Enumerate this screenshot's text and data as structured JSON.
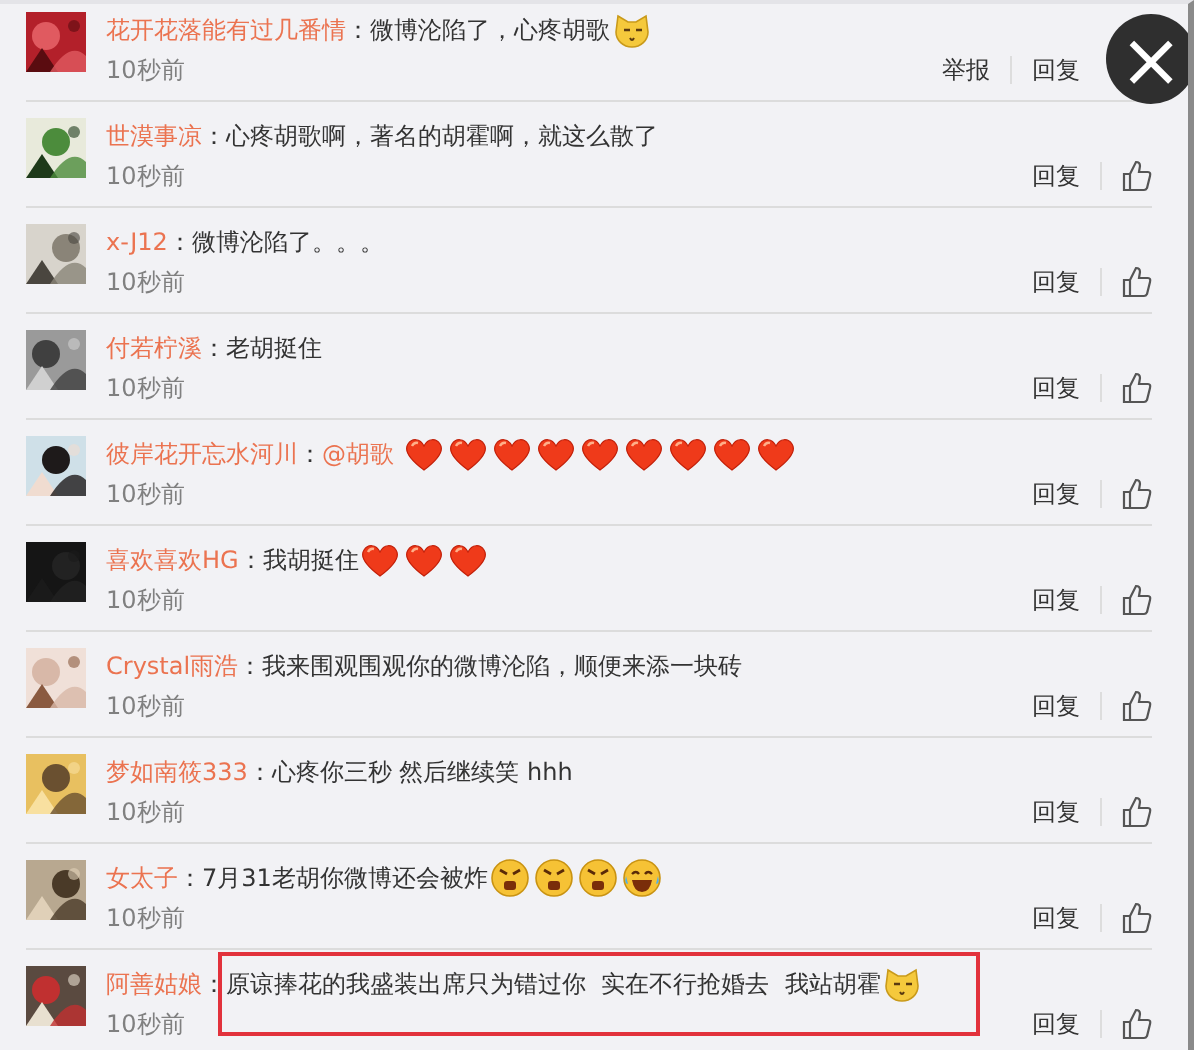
{
  "comments": [
    {
      "user": "花开花落能有过几番情",
      "sep": "：",
      "text": "微博沦陷了，心疼胡歌",
      "emojis": [
        {
          "kind": "cat"
        }
      ],
      "time": "10秒前",
      "actions": [
        "举报",
        "回复"
      ],
      "like": false,
      "highlighted": false
    },
    {
      "user": "世漠事凉",
      "sep": "：",
      "text": "心疼胡歌啊，著名的胡霍啊，就这么散了",
      "time": "10秒前",
      "actions": [
        "回复"
      ],
      "like": true,
      "highlighted": false
    },
    {
      "user": "x-J12",
      "sep": "：",
      "text": "微博沦陷了。。。",
      "time": "10秒前",
      "actions": [
        "回复"
      ],
      "like": true,
      "highlighted": false
    },
    {
      "user": "付若柠溪",
      "sep": "：",
      "text": "老胡挺住",
      "time": "10秒前",
      "actions": [
        "回复"
      ],
      "like": true,
      "highlighted": false
    },
    {
      "user": "彼岸花开忘水河川",
      "sep": "：",
      "mention": "@胡歌",
      "emojis": [
        {
          "kind": "heart"
        },
        {
          "kind": "heart"
        },
        {
          "kind": "heart"
        },
        {
          "kind": "heart"
        },
        {
          "kind": "heart"
        },
        {
          "kind": "heart"
        },
        {
          "kind": "heart"
        },
        {
          "kind": "heart"
        },
        {
          "kind": "heart"
        }
      ],
      "time": "10秒前",
      "actions": [
        "回复"
      ],
      "like": true,
      "highlighted": false
    },
    {
      "user": "喜欢喜欢HG",
      "sep": "：",
      "text": "我胡挺住",
      "emojis": [
        {
          "kind": "heart"
        },
        {
          "kind": "heart"
        },
        {
          "kind": "heart"
        }
      ],
      "time": "10秒前",
      "actions": [
        "回复"
      ],
      "like": true,
      "highlighted": false
    },
    {
      "user": "Crystal雨浩",
      "sep": "：",
      "text": "我来围观围观你的微博沦陷，顺便来添一块砖",
      "time": "10秒前",
      "actions": [
        "回复"
      ],
      "like": true,
      "highlighted": false
    },
    {
      "user": "梦如南筱333",
      "sep": "：",
      "text": "心疼你三秒 然后继续笑 hhh",
      "time": "10秒前",
      "actions": [
        "回复"
      ],
      "like": true,
      "highlighted": false
    },
    {
      "user": "女太子",
      "sep": "：",
      "text": "7月31老胡你微博还会被炸",
      "emojis": [
        {
          "kind": "angry"
        },
        {
          "kind": "angry"
        },
        {
          "kind": "angry"
        },
        {
          "kind": "laugh"
        }
      ],
      "time": "10秒前",
      "actions": [
        "回复"
      ],
      "like": true,
      "highlighted": false
    },
    {
      "user": "阿善姑娘",
      "sep": "：",
      "text": "原谅捧花的我盛装出席只为错过你  实在不行抢婚去  我站胡霍",
      "emojis": [
        {
          "kind": "cat"
        }
      ],
      "time": "10秒前",
      "actions": [
        "回复"
      ],
      "like": true,
      "highlighted": true
    }
  ],
  "close": {
    "label": "×"
  }
}
